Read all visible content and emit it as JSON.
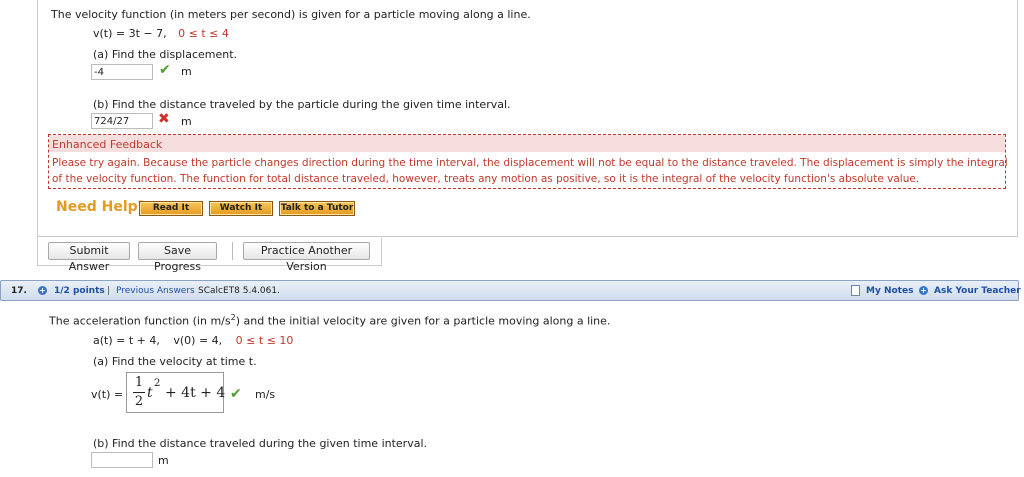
{
  "q16": {
    "intro": "The velocity function (in meters per second) is given for a particle moving along a line.",
    "func_text": "v(t) = 3t − 7,",
    "domain_text": "0 ≤ t ≤ 4",
    "part_a": {
      "prompt": "(a) Find the displacement.",
      "value": "-4",
      "status": "correct",
      "unit": "m"
    },
    "part_b": {
      "prompt": "(b) Find the distance traveled by the particle during the given time interval.",
      "value": "724/27",
      "status": "incorrect",
      "unit": "m"
    },
    "feedback": {
      "title": "Enhanced Feedback",
      "line1": "Please try again. Because the particle changes direction during the time interval, the displacement will not be equal to the distance traveled. The displacement is simply the integral",
      "line2": "of the velocity function. The function for total distance traveled, however, treats any motion as positive, so it is the integral of the velocity function's absolute value."
    },
    "help": {
      "label": "Need Help?",
      "buttons": [
        "Read It",
        "Watch It",
        "Talk to a Tutor"
      ]
    },
    "actions": {
      "submit": "Submit Answer",
      "save": "Save Progress",
      "practice": "Practice Another Version"
    }
  },
  "q17": {
    "number": "17.",
    "points": "1/2 points",
    "separator": "|",
    "previous": "Previous Answers",
    "ref": "SCalcET8 5.4.061.",
    "notes": "My Notes",
    "ask": "Ask Your Teacher",
    "intro_start": "The acceleration function (in m/s",
    "intro_sup": "2",
    "intro_end": ") and the initial velocity are given for a particle moving along a line.",
    "func_text": "a(t) = t + 4,",
    "init_text": "v(0) = 4,",
    "domain_text": "0 ≤ t ≤ 10",
    "part_a": {
      "prompt": "(a) Find the velocity at time t.",
      "lhs": "v(t) =",
      "frac_num": "1",
      "frac_den": "2",
      "var": "t",
      "exp": "2",
      "rest": "+ 4t + 4",
      "status": "correct",
      "unit": "m/s"
    },
    "part_b": {
      "prompt": "(b) Find the distance traveled during the given time interval.",
      "value": "",
      "unit": "m"
    }
  },
  "colors": {
    "correct": "#4a9d2a",
    "incorrect": "#d0312d",
    "feedback_red": "#c0392b",
    "help_orange": "#e49a1f",
    "link_blue": "#1f4fa3"
  },
  "icons": {
    "correct": "check-icon",
    "incorrect": "x-icon",
    "points": "plus-circle-icon",
    "notes": "notes-icon",
    "ask": "plus-circle-icon"
  }
}
